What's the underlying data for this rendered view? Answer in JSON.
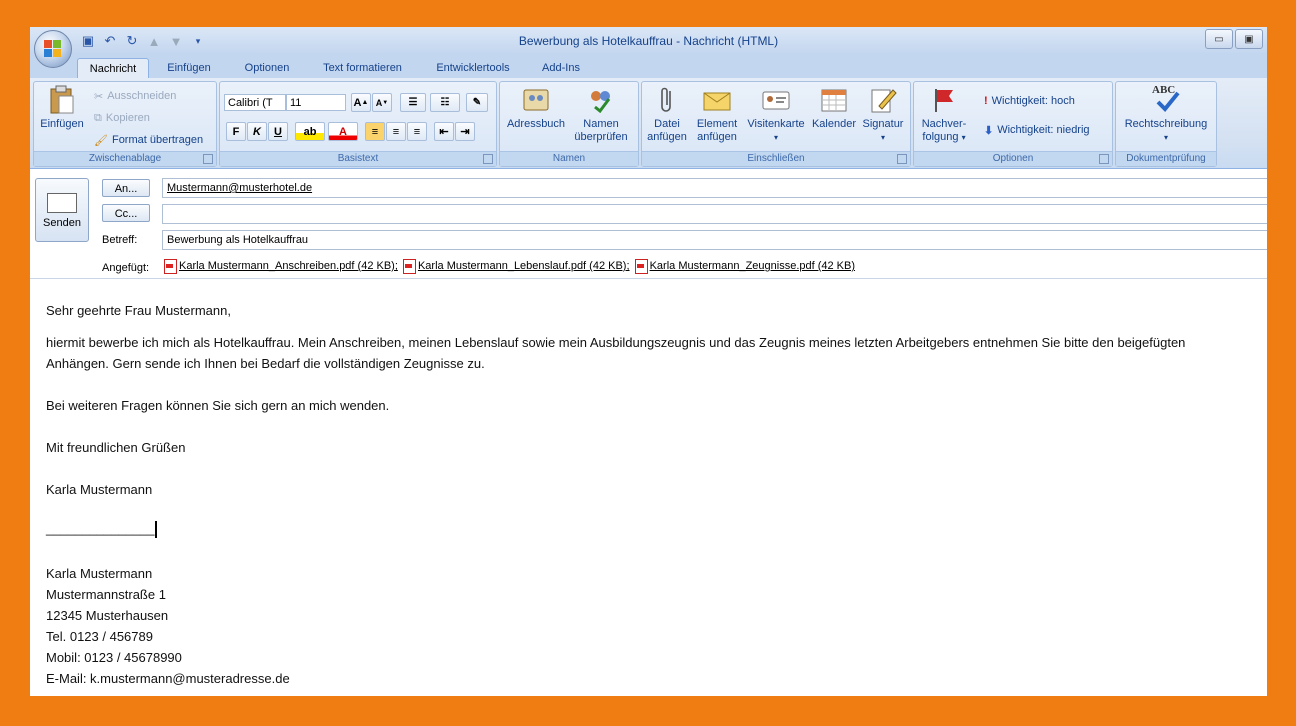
{
  "window": {
    "title": "Bewerbung als Hotelkauffrau - Nachricht (HTML)",
    "min": "▭",
    "max": "▣",
    "close": "✕"
  },
  "tabs": [
    {
      "label": "Nachricht",
      "active": true
    },
    {
      "label": "Einfügen"
    },
    {
      "label": "Optionen"
    },
    {
      "label": "Text formatieren"
    },
    {
      "label": "Entwicklertools"
    },
    {
      "label": "Add-Ins"
    }
  ],
  "ribbon": {
    "clipboard": {
      "label": "Zwischenablage",
      "paste": "Einfügen",
      "cut": "Ausschneiden",
      "copy": "Kopieren",
      "format_painter": "Format übertragen"
    },
    "basic_text": {
      "label": "Basistext",
      "font": "Calibri (T",
      "size": "11",
      "bold": "F",
      "italic": "K",
      "underline": "U"
    },
    "names": {
      "label": "Namen",
      "address_book": "Adressbuch",
      "check_names_1": "Namen",
      "check_names_2": "überprüfen"
    },
    "include": {
      "label": "Einschließen",
      "attach_file_1": "Datei",
      "attach_file_2": "anfügen",
      "attach_item_1": "Element",
      "attach_item_2": "anfügen",
      "business_card": "Visitenkarte",
      "calendar": "Kalender",
      "signature": "Signatur"
    },
    "options": {
      "label": "Optionen",
      "follow_up_1": "Nachver-",
      "follow_up_2": "folgung",
      "importance_high": "Wichtigkeit: hoch",
      "importance_low": "Wichtigkeit: niedrig"
    },
    "proofing": {
      "label": "Dokumentprüfung",
      "spelling": "Rechtschreibung",
      "abc": "ABC"
    }
  },
  "header": {
    "send": "Senden",
    "to_button": "An...",
    "cc_button": "Cc...",
    "to_value": "Mustermann@musterhotel.de",
    "cc_value": "",
    "subject_label": "Betreff:",
    "subject_value": "Bewerbung als Hotelkauffrau",
    "attached_label": "Angefügt:",
    "attachments": [
      "Karla Mustermann_Anschreiben.pdf (42 KB);",
      "Karla Mustermann_Lebenslauf.pdf (42 KB);",
      "Karla Mustermann_Zeugnisse.pdf (42 KB)"
    ]
  },
  "body": {
    "greeting": "Sehr geehrte Frau Mustermann,",
    "para1_line1": "hiermit bewerbe ich mich als Hotelkauffrau. Mein Anschreiben, meinen Lebenslauf sowie mein Ausbildungszeugnis und das Zeugnis meines letzten Arbeitgebers entnehmen Sie bitte den beigefügten",
    "para1_line2": "Anhängen. Gern sende ich Ihnen bei Bedarf die vollständigen Zeugnisse zu.",
    "para2": "Bei weiteren Fragen können Sie sich gern an mich wenden.",
    "closing": "Mit freundlichen Grüßen",
    "name": "Karla Mustermann",
    "signature_line": "_______________",
    "sig_name": "Karla Mustermann",
    "sig_street": "Mustermannstraße 1",
    "sig_city": "12345 Musterhausen",
    "sig_tel": "Tel. 0123 / 456789",
    "sig_mobile": "Mobil: 0123 / 45678990",
    "sig_email": "E-Mail: k.mustermann@musteradresse.de"
  }
}
